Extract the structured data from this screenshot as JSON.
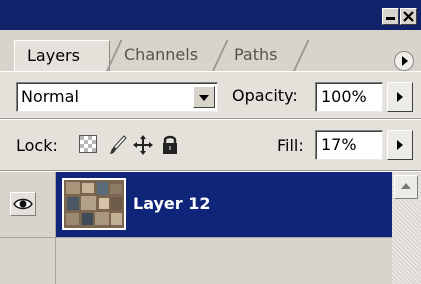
{
  "window": {
    "minimize_icon": "minimize-icon",
    "close_icon": "close-icon"
  },
  "tabs": [
    {
      "label": "Layers",
      "active": true
    },
    {
      "label": "Channels",
      "active": false
    },
    {
      "label": "Paths",
      "active": false
    }
  ],
  "blend_mode": {
    "value": "Normal"
  },
  "opacity": {
    "label": "Opacity:",
    "value": "100%"
  },
  "lock": {
    "label": "Lock:",
    "icons": [
      "lock-transparent-pixels-icon",
      "lock-image-pixels-icon",
      "lock-position-icon",
      "lock-all-icon"
    ]
  },
  "fill": {
    "label": "Fill:",
    "value": "17%"
  },
  "layers": [
    {
      "name": "Layer 12",
      "visible": true,
      "selected": true
    }
  ],
  "colors": {
    "title_bar": "#11226a",
    "selection": "#0f2579",
    "panel_bg": "#e4e1da"
  }
}
